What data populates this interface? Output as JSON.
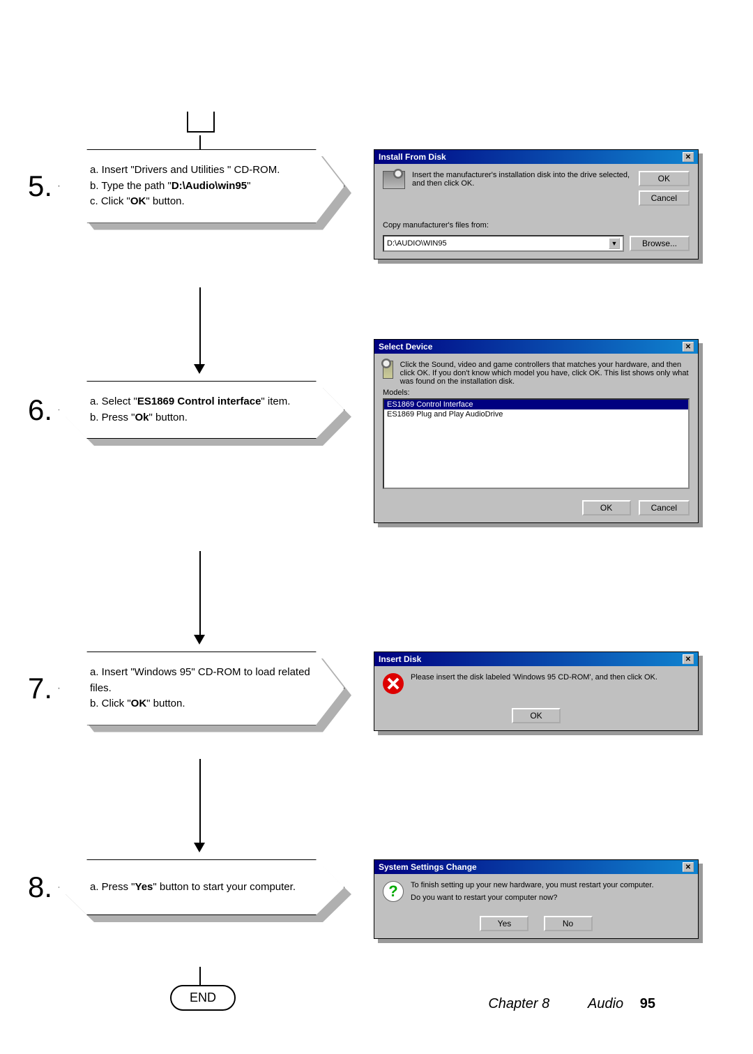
{
  "steps": {
    "s5": {
      "num": "5.",
      "a": "a. Insert \"Drivers and Utilities \" CD-ROM.",
      "b_pre": "b. Type the path \"",
      "b_bold": "D:\\Audio\\win95",
      "b_post": "\"",
      "c_pre": "c. Click \"",
      "c_bold": "OK",
      "c_post": "\" button."
    },
    "s6": {
      "num": "6.",
      "a_pre": "a. Select \"",
      "a_bold": "ES1869 Control interface",
      "a_post": "\" item.",
      "b_pre": "b. Press \"",
      "b_bold": "Ok",
      "b_post": "\" button."
    },
    "s7": {
      "num": "7.",
      "a": "a. Insert \"Windows 95\" CD-ROM to load related files.",
      "b_pre": "b. Click \"",
      "b_bold": "OK",
      "b_post": "\" button."
    },
    "s8": {
      "num": "8.",
      "a_pre": "a. Press  \"",
      "a_bold": "Yes",
      "a_post": "\" button to start your computer."
    }
  },
  "end": "END",
  "dlg5": {
    "title": "Install From Disk",
    "msg": "Insert the manufacturer's installation disk into the drive selected, and then click OK.",
    "ok": "OK",
    "cancel": "Cancel",
    "copylabel": "Copy manufacturer's files from:",
    "path": "D:\\AUDIO\\WIN95",
    "browse": "Browse..."
  },
  "dlg6": {
    "title": "Select Device",
    "msg": "Click the Sound, video and game controllers that matches your hardware, and then click OK. If you don't know which model you have, click OK. This list shows only what was found on the installation disk.",
    "models": "Models:",
    "item1": "ES1869 Control Interface",
    "item2": "ES1869 Plug and Play AudioDrive",
    "ok": "OK",
    "cancel": "Cancel"
  },
  "dlg7": {
    "title": "Insert Disk",
    "msg": "Please insert the disk labeled 'Windows 95 CD-ROM', and then click OK.",
    "ok": "OK"
  },
  "dlg8": {
    "title": "System Settings Change",
    "msg1": "To finish setting up your new hardware, you must restart your computer.",
    "msg2": "Do you want to restart your computer now?",
    "yes": "Yes",
    "no": "No"
  },
  "footer": {
    "chapter": "Chapter 8",
    "section": "Audio",
    "page": "95"
  }
}
